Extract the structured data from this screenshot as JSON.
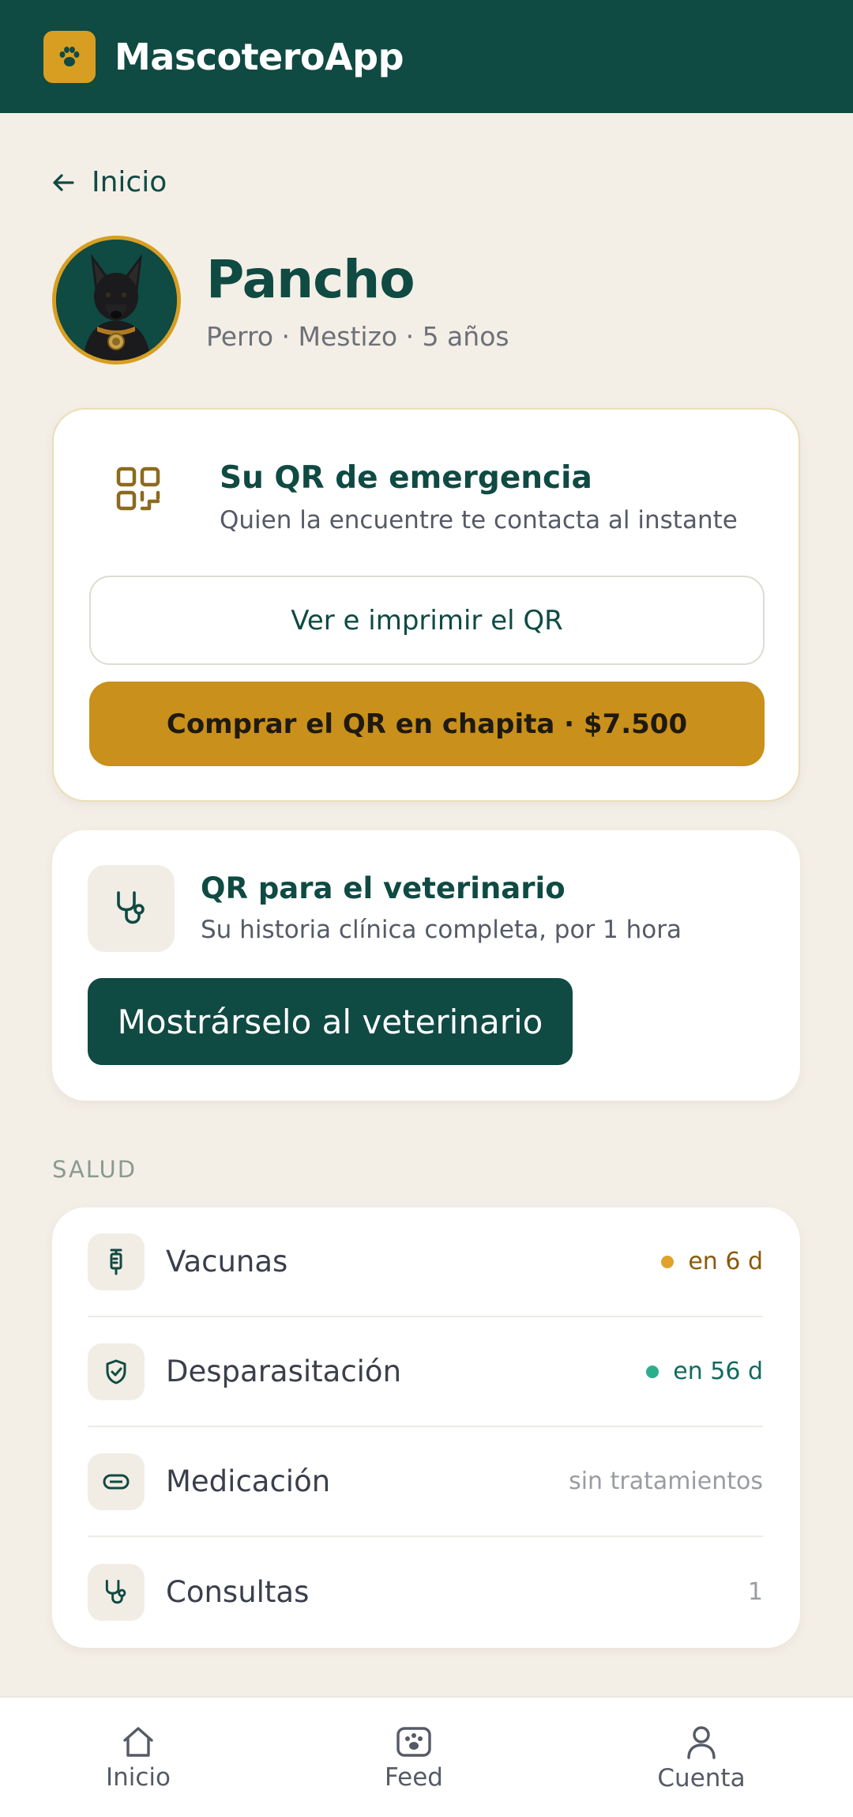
{
  "app": {
    "title": "MascoteroApp",
    "logo_icon": "paw-icon",
    "brand_color": "#0F4A43",
    "accent_color": "#D79E22"
  },
  "nav_back": {
    "label": "Inicio",
    "icon": "arrow-left-icon"
  },
  "pet": {
    "name": "Pancho",
    "details": "Perro · Mestizo · 5 años"
  },
  "emergency_qr": {
    "icon": "qr-code-icon",
    "title": "Su QR de emergencia",
    "subtitle": "Quien la encuentre te contacta al instante",
    "view_button": "Ver e imprimir el QR",
    "buy_button": "Comprar el QR en chapita · $7.500"
  },
  "vet_qr": {
    "icon": "stethoscope-icon",
    "title": "QR para el veterinario",
    "subtitle": "Su historia clínica completa, por 1 hora",
    "button": "Mostrárselo al veterinario"
  },
  "health": {
    "section_label": "SALUD",
    "items": [
      {
        "label": "Vacunas",
        "status": "en 6 d",
        "icon": "syringe-icon",
        "status_color": "#8A5A0A",
        "dot_color": "#E0A22A"
      },
      {
        "label": "Desparasitación",
        "status": "en 56 d",
        "icon": "shield-check-icon",
        "status_color": "#0F6B5E",
        "dot_color": "#2BAE8C"
      },
      {
        "label": "Medicación",
        "status": "sin tratamientos",
        "icon": "pill-icon",
        "status_color": "#9A9CA3"
      },
      {
        "label": "Consultas",
        "status": "1",
        "icon": "stethoscope-icon",
        "status_color": "#9A9CA3"
      }
    ]
  },
  "bottom_nav": [
    {
      "label": "Inicio",
      "icon": "home-icon"
    },
    {
      "label": "Feed",
      "icon": "paw-feed-icon"
    },
    {
      "label": "Cuenta",
      "icon": "user-icon"
    }
  ]
}
